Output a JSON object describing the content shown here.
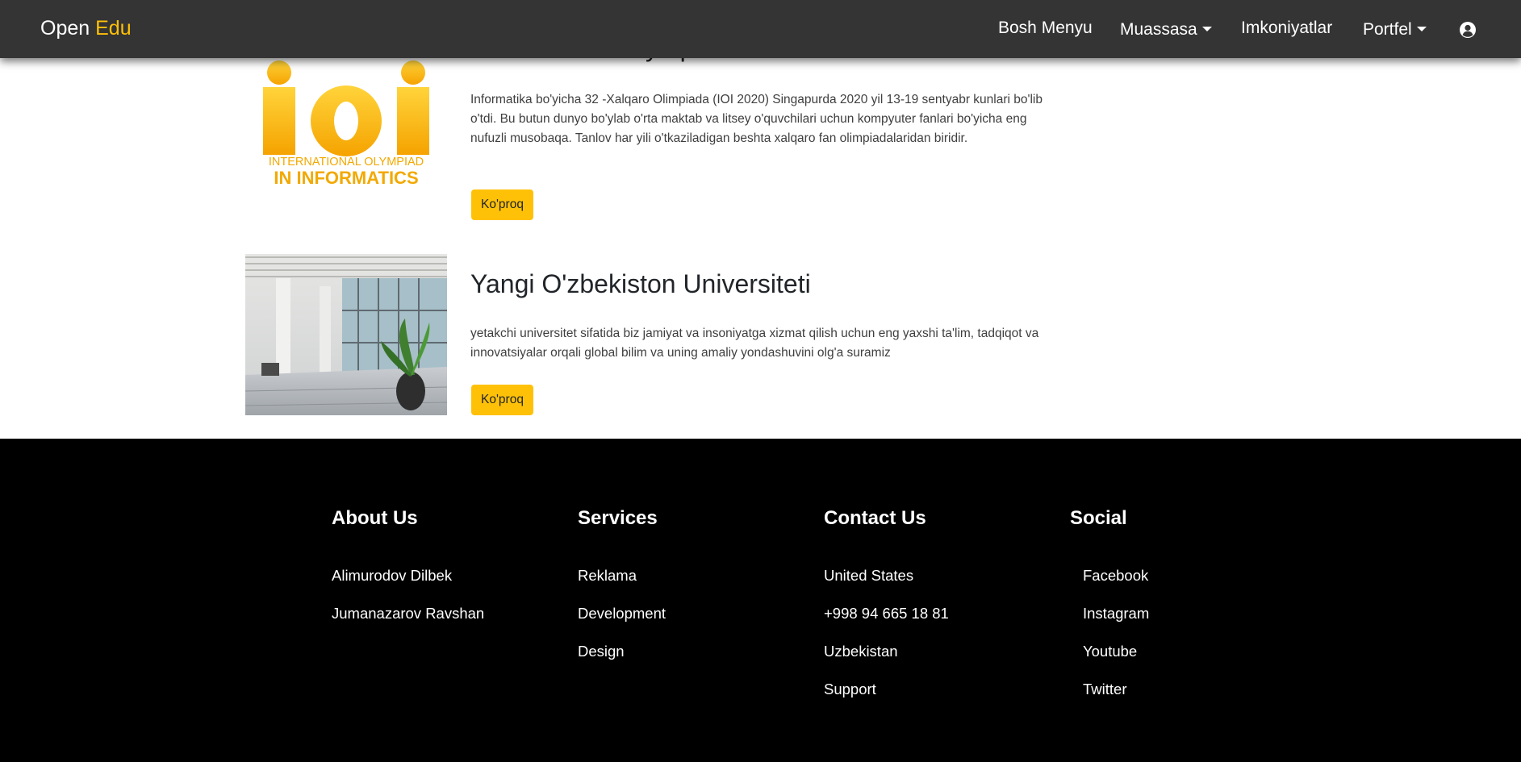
{
  "navbar": {
    "brand_part1": "Open",
    "brand_part2": "Edu",
    "links": [
      {
        "label": "Bosh Menyu"
      },
      {
        "label": "Muassasa"
      },
      {
        "label": "Imkoniyatlar"
      },
      {
        "label": "Portfel"
      }
    ],
    "user_icon": "user-circle-icon"
  },
  "cards": [
    {
      "title": "International Olympiad in Informatics",
      "text": "Informatika bo'yicha 32 -Xalqaro Olimpiada (IOI 2020) Singapurda 2020 yil 13-19 sentyabr kunlari bo'lib o'tdi. Bu butun dunyo bo'ylab o'rta maktab va litsey o'quvchilari uchun kompyuter fanlari bo'yicha eng nufuzli musobaqa. Tanlov har yili o'tkaziladigan beshta xalqaro fan olimpiadalaridan biridir.",
      "button": "Ko'proq",
      "logo": {
        "main": "IOI",
        "line1": "INTERNATIONAL OLYMPIAD",
        "line2": "IN INFORMATICS"
      }
    },
    {
      "title": "Yangi O'zbekiston Universiteti",
      "text": "yetakchi universitet sifatida biz jamiyat va insoniyatga xizmat qilish uchun eng yaxshi ta'lim, tadqiqot va innovatsiyalar orqali global bilim va uning amaliy yondashuvini olg'a suramiz",
      "button": "Ko'proq"
    }
  ],
  "footer": {
    "about": {
      "heading": "About Us",
      "items": [
        "Alimurodov Dilbek",
        "Jumanazarov Ravshan"
      ]
    },
    "services": {
      "heading": "Services",
      "items": [
        "Reklama",
        "Development",
        "Design"
      ]
    },
    "contact": {
      "heading": "Contact Us",
      "items": [
        "United States",
        "+998 94 665 18 81",
        "Uzbekistan",
        "Support"
      ]
    },
    "social": {
      "heading": "Social",
      "items": [
        "Facebook",
        "Instagram",
        "Youtube",
        "Twitter"
      ]
    }
  },
  "colors": {
    "accent": "#ffc107",
    "navbar": "#343434",
    "footer": "#000000"
  }
}
